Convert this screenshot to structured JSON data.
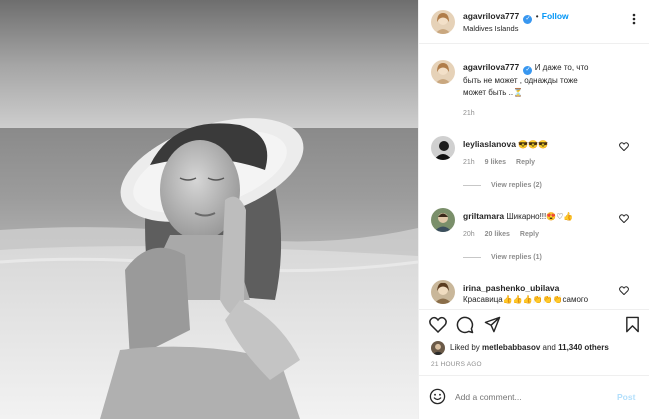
{
  "post": {
    "author": "agavrilova777",
    "follow_label": "Follow",
    "location": "Maldives Islands",
    "caption": {
      "username": "agavrilova777",
      "line1": "И даже то, что",
      "line2": "быть не может , однажды тоже",
      "line3": "может быть ..⏳",
      "time": "21h"
    },
    "comments": [
      {
        "username": "leyliaslanova",
        "text": "😎😎😎",
        "time": "21h",
        "likes": "9 likes",
        "reply_label": "Reply",
        "view_replies": "View replies (2)"
      },
      {
        "username": "griltamara",
        "text": "Шикарно!!!😍♡👍",
        "time": "20h",
        "likes": "20 likes",
        "reply_label": "Reply",
        "view_replies": "View replies (1)"
      },
      {
        "username": "irina_pashenko_ubilava",
        "text": "Красавица👍👍👍👏👏👏самого"
      }
    ],
    "liked_by": {
      "prefix": "Liked by",
      "user": "metlebabbasov",
      "middle": "and",
      "others": "11,340 others"
    },
    "timestamp": "21 HOURS AGO",
    "comment_placeholder": "Add a comment...",
    "post_label": "Post"
  },
  "colors": {
    "accent": "#0095f6",
    "verified": "#3897f0",
    "muted": "#8e8e8e",
    "post_disabled": "#b2dffc"
  },
  "icons": [
    "heart-icon",
    "comment-icon",
    "share-icon",
    "save-icon",
    "emoji-icon",
    "more-icon",
    "verified-badge"
  ]
}
